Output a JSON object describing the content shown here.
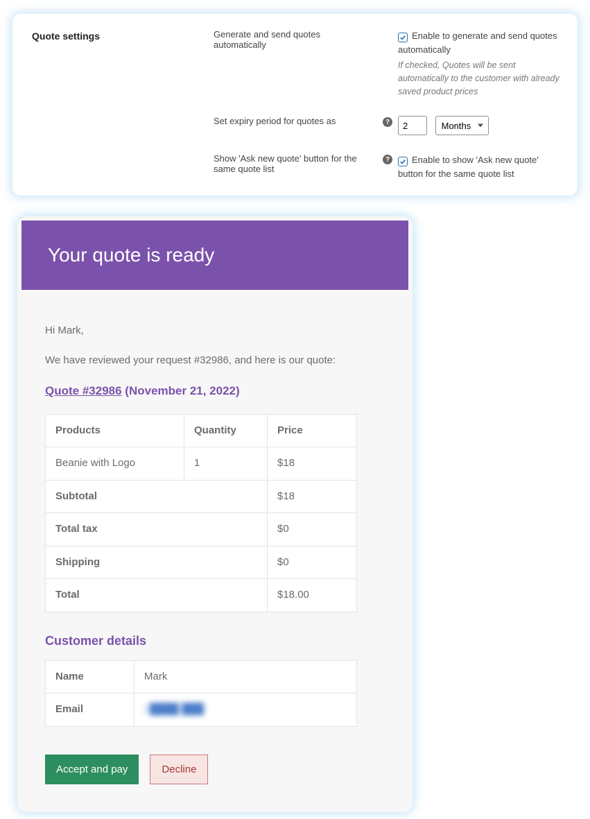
{
  "settings": {
    "title": "Quote settings",
    "generate": {
      "label": "Generate and send quotes automatically",
      "checkbox_label": "Enable to generate and send quotes automatically",
      "checked": true,
      "hint": "If checked, Quotes will be sent automatically to the customer with already saved product prices"
    },
    "expiry": {
      "label": "Set expiry period for quotes as",
      "value": "2",
      "unit": "Months"
    },
    "ask_new": {
      "label": "Show 'Ask new quote' button for the same quote list",
      "checkbox_label": "Enable to show 'Ask new quote' button for the same quote list",
      "checked": true
    }
  },
  "email": {
    "heading": "Your quote is ready",
    "greeting": "Hi Mark,",
    "intro": "We have reviewed your request #32986, and here is our quote:",
    "quote_link": "Quote #32986",
    "quote_date": "(November 21, 2022)",
    "table": {
      "col_products": "Products",
      "col_quantity": "Quantity",
      "col_price": "Price",
      "item_name": "Beanie with Logo",
      "item_qty": "1",
      "item_price": "$18",
      "subtotal_label": "Subtotal",
      "subtotal": "$18",
      "tax_label": "Total tax",
      "tax": "$0",
      "shipping_label": "Shipping",
      "shipping": "$0",
      "total_label": "Total",
      "total": "$18.00"
    },
    "customer": {
      "heading": "Customer details",
      "name_label": "Name",
      "name": "Mark",
      "email_label": "Email",
      "email": "i   ████   ███"
    },
    "accept": "Accept and pay",
    "decline": "Decline"
  }
}
